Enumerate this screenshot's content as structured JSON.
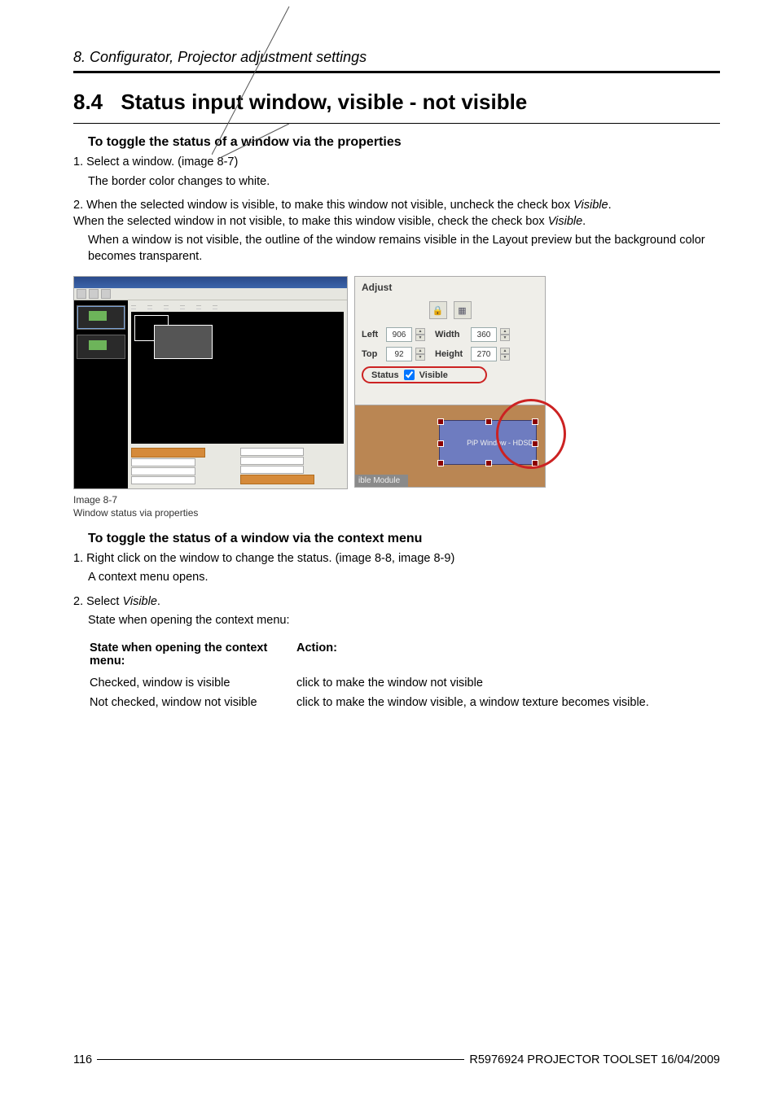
{
  "header": {
    "running": "8.  Configurator, Projector adjustment settings"
  },
  "section": {
    "number": "8.4",
    "title": "Status input window, visible - not visible"
  },
  "sub1": {
    "title": "To toggle the status of a window via the properties",
    "step1": "1. Select a window.  (image 8-7)",
    "step1_body": "The border color changes to white.",
    "step2a": "2. When the selected window is visible, to make this window not visible, uncheck the check box ",
    "step2b": "When the selected window in not visible, to make this window visible, check the check box ",
    "visible_word": "Visible",
    "step2_body": "When a window is not visible, the outline of the window remains visible in the Layout preview but the background color becomes transparent."
  },
  "figure": {
    "adjust_title": "Adjust",
    "left_lbl": "Left",
    "left_val": "906",
    "top_lbl": "Top",
    "top_val": "92",
    "width_lbl": "Width",
    "width_val": "360",
    "height_lbl": "Height",
    "height_val": "270",
    "status_lbl": "Status",
    "visible_lbl": "Visible",
    "pip_label": "PiP Window - HDSD",
    "module_label": "ible Module",
    "lock_icon": "🔒",
    "snap_icon": "▦",
    "caption_num": "Image 8-7",
    "caption_text": "Window status via properties"
  },
  "sub2": {
    "title": "To toggle the status of a window via the context menu",
    "step1": "1. Right click on the window to change the status.  (image 8-8, image 8-9)",
    "step1_body": "A context menu opens.",
    "step2": "2. Select ",
    "visible_word": "Visible",
    "lead": "State when opening the context menu:",
    "hdr_state": "State when opening the context menu:",
    "hdr_action": "Action:",
    "r1_state": "Checked, window is visible",
    "r1_action": "click to make the window not visible",
    "r2_state": "Not checked, window not visible",
    "r2_action": "click to make the window visible, a window texture becomes visible."
  },
  "footer": {
    "page": "116",
    "doc": "R5976924   PROJECTOR TOOLSET   16/04/2009"
  }
}
